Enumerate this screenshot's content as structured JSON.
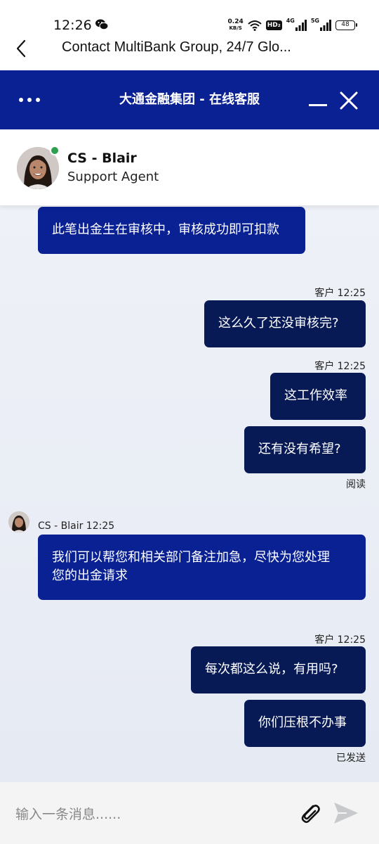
{
  "status_bar": {
    "time": "12:26",
    "net_speed_value": "0.24",
    "net_speed_unit": "KB/S",
    "hd_label": "HD₂",
    "signal_1_label": "4G",
    "signal_2_label": "5G",
    "battery_level": "48",
    "icons": [
      "wechat-icon",
      "wifi-icon",
      "signal-icon",
      "battery-icon"
    ]
  },
  "browser": {
    "title": "Contact MultiBank Group, 24/7 Glo..."
  },
  "chat_header": {
    "title": "大通金融集团 - 在线客服"
  },
  "agent": {
    "name": "CS - Blair",
    "role": "Support Agent",
    "online_color": "#2e9e4f"
  },
  "messages": {
    "m1": {
      "text": "此笔出金生在审核中，审核成功即可扣款"
    },
    "m2_meta": "客户 12:25",
    "m2": {
      "text": "这么久了还没审核完?"
    },
    "m3_meta": "客户 12:25",
    "m3": {
      "text": "这工作效率"
    },
    "m4": {
      "text": "还有没有希望?"
    },
    "m4_status": "阅读",
    "m5_meta": "CS - Blair 12:25",
    "m5_line1": "我们可以帮您和相关部门备注加急，尽快为您处理",
    "m5_line2": "您的出金请求",
    "m6_meta": "客户 12:25",
    "m6": {
      "text": "每次都这么说，有用吗?"
    },
    "m7": {
      "text": "你们压根不办事"
    },
    "m7_status": "已发送"
  },
  "input": {
    "placeholder": "输入一条消息......"
  },
  "colors": {
    "header_bg": "#0a2194",
    "agent_bubble": "#0a2194",
    "customer_bubble": "#071a55",
    "chat_bg": "#eef1f7"
  }
}
